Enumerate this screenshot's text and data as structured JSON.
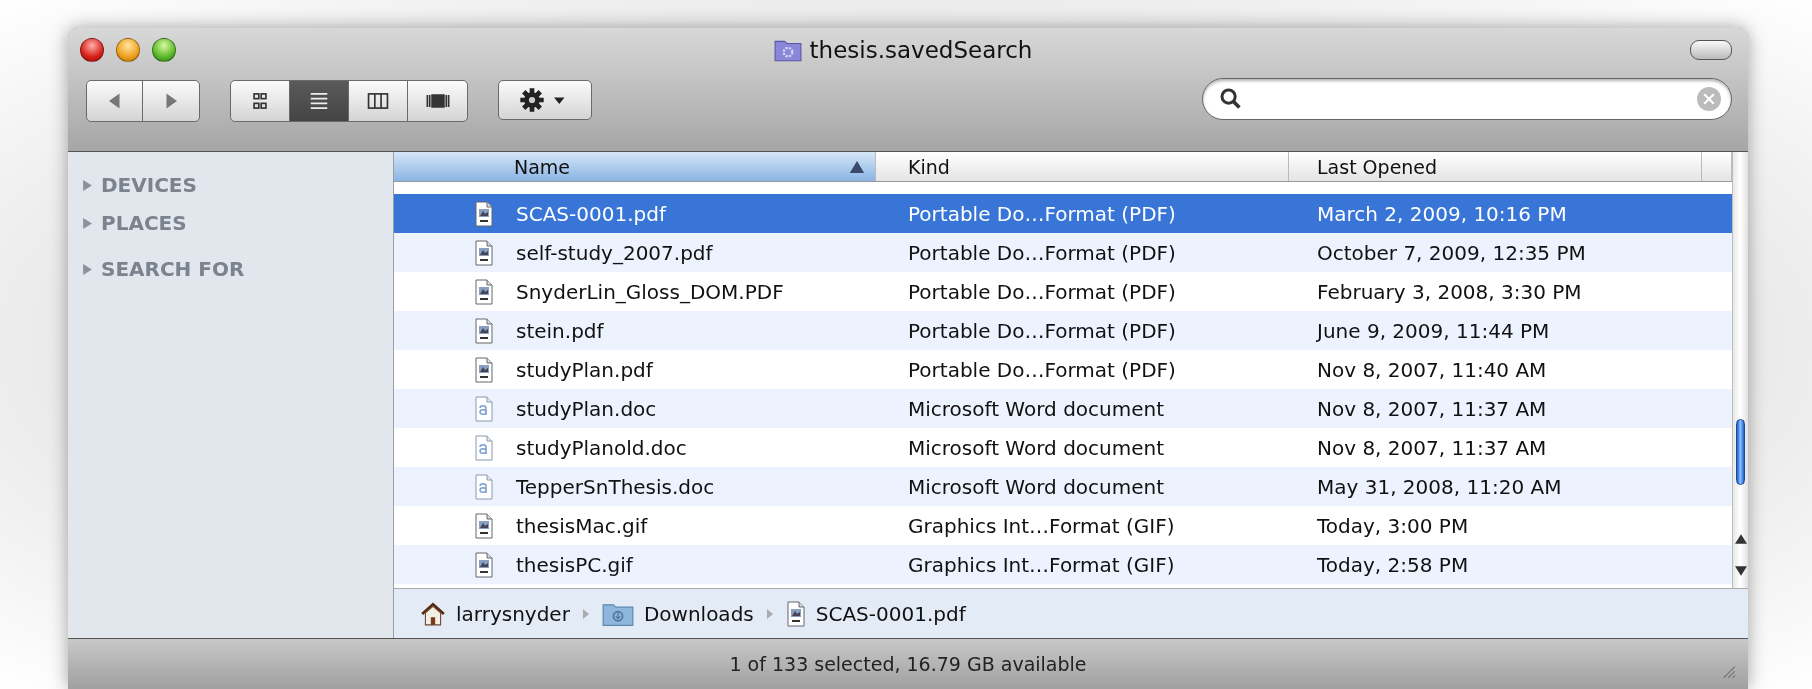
{
  "window": {
    "title": "thesis.savedSearch"
  },
  "toolbar": {
    "view_buttons": [
      {
        "kind": "icons",
        "selected": false
      },
      {
        "kind": "list",
        "selected": true
      },
      {
        "kind": "columns",
        "selected": false
      },
      {
        "kind": "coverflow",
        "selected": false
      }
    ]
  },
  "sidebar": {
    "sections": [
      {
        "label": "DEVICES",
        "expanded": false
      },
      {
        "label": "PLACES",
        "expanded": false
      },
      {
        "label": "SEARCH FOR",
        "expanded": false
      }
    ]
  },
  "table": {
    "columns": [
      {
        "label": "Name",
        "selected": true
      },
      {
        "label": "Kind",
        "selected": false
      },
      {
        "label": "Last Opened",
        "selected": false
      }
    ],
    "rows": [
      {
        "kind": "preview",
        "name": "SCAS-0001.pdf",
        "file_kind": "Portable Do…Format (PDF)",
        "last_opened": "March 2, 2009, 10:16 PM",
        "selected": true
      },
      {
        "kind": "preview",
        "name": "self-study_2007.pdf",
        "file_kind": "Portable Do…Format (PDF)",
        "last_opened": "October 7, 2009, 12:35 PM",
        "selected": false
      },
      {
        "kind": "preview",
        "name": "SnyderLin_Gloss_DOM.PDF",
        "file_kind": "Portable Do…Format (PDF)",
        "last_opened": "February 3, 2008, 3:30 PM",
        "selected": false
      },
      {
        "kind": "preview",
        "name": "stein.pdf",
        "file_kind": "Portable Do…Format (PDF)",
        "last_opened": "June 9, 2009, 11:44 PM",
        "selected": false
      },
      {
        "kind": "preview",
        "name": "studyPlan.pdf",
        "file_kind": "Portable Do…Format (PDF)",
        "last_opened": "Nov 8, 2007, 11:40 AM",
        "selected": false
      },
      {
        "kind": "word",
        "name": "studyPlan.doc",
        "file_kind": "Microsoft Word document",
        "last_opened": "Nov 8, 2007, 11:37 AM",
        "selected": false
      },
      {
        "kind": "word",
        "name": "studyPlanold.doc",
        "file_kind": "Microsoft Word document",
        "last_opened": "Nov 8, 2007, 11:37 AM",
        "selected": false
      },
      {
        "kind": "word",
        "name": "TepperSnThesis.doc",
        "file_kind": "Microsoft Word document",
        "last_opened": "May 31, 2008, 11:20 AM",
        "selected": false
      },
      {
        "kind": "preview",
        "name": "thesisMac.gif",
        "file_kind": "Graphics Int…Format (GIF)",
        "last_opened": "Today, 3:00 PM",
        "selected": false
      },
      {
        "kind": "preview",
        "name": "thesisPC.gif",
        "file_kind": "Graphics Int…Format (GIF)",
        "last_opened": "Today, 2:58 PM",
        "selected": false
      }
    ]
  },
  "path_bar": [
    {
      "kind": "home",
      "label": "larrysnyder"
    },
    {
      "kind": "folder",
      "label": "Downloads"
    },
    {
      "kind": "file",
      "label": "SCAS-0001.pdf"
    }
  ],
  "status_bar": "1 of 133 selected, 16.79 GB available"
}
